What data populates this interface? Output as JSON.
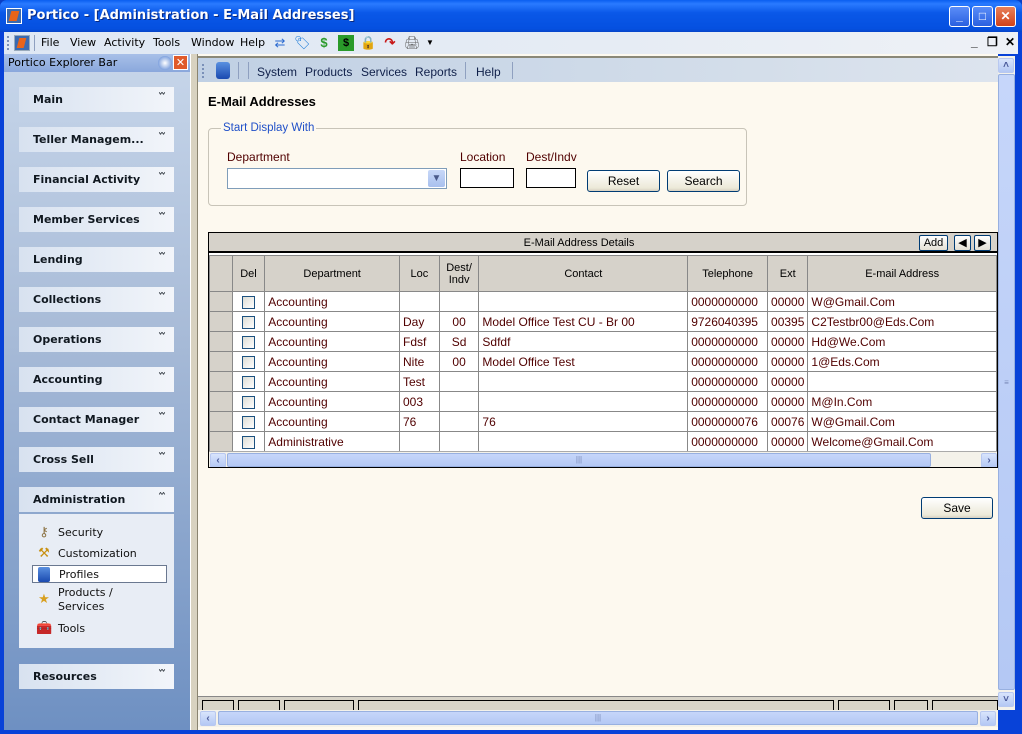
{
  "window": {
    "title": "Portico - [Administration - E-Mail Addresses]",
    "controls": {
      "minimize": "_",
      "maximize": "□",
      "close": "✕"
    }
  },
  "menubar": {
    "items": [
      "File",
      "View",
      "Activity",
      "Tools",
      "Window",
      "Help"
    ],
    "toolbar_icons": [
      "transfer-icon",
      "tag-icon",
      "dollar-icon",
      "cash-drawer-icon",
      "lock-icon",
      "redo-arrow-icon",
      "printer-icon"
    ],
    "mdi_controls": {
      "minimize": "_",
      "restore": "❐",
      "close": "✕"
    }
  },
  "explorer": {
    "title": "Portico Explorer Bar",
    "groups": [
      {
        "label": "Main",
        "expanded": false
      },
      {
        "label": "Teller Managem...",
        "expanded": false
      },
      {
        "label": "Financial Activity",
        "expanded": false
      },
      {
        "label": "Member Services",
        "expanded": false
      },
      {
        "label": "Lending",
        "expanded": false
      },
      {
        "label": "Collections",
        "expanded": false
      },
      {
        "label": "Operations",
        "expanded": false
      },
      {
        "label": "Accounting",
        "expanded": false
      },
      {
        "label": "Contact Manager",
        "expanded": false
      },
      {
        "label": "Cross Sell",
        "expanded": false
      },
      {
        "label": "Administration",
        "expanded": true
      },
      {
        "label": "Resources",
        "expanded": false
      }
    ],
    "admin_items": [
      {
        "label": "Security",
        "icon": "keys-icon",
        "selected": false
      },
      {
        "label": "Customization",
        "icon": "hardhat-hammer-icon",
        "selected": false
      },
      {
        "label": "Profiles",
        "icon": "profile-cabinet-icon",
        "selected": true
      },
      {
        "label": "Products / Services",
        "icon": "star-hand-icon",
        "selected": false
      },
      {
        "label": "Tools",
        "icon": "toolbox-icon",
        "selected": false
      }
    ]
  },
  "inner_toolbar": {
    "items": [
      "System",
      "Products",
      "Services",
      "Reports",
      "Help"
    ]
  },
  "page": {
    "title": "E-Mail Addresses",
    "filter": {
      "legend": "Start Display With",
      "department_label": "Department",
      "department_value": "",
      "location_label": "Location",
      "location_value": "",
      "destindv_label": "Dest/Indv",
      "destindv_value": "",
      "reset_label": "Reset",
      "search_label": "Search"
    },
    "grid": {
      "caption": "E-Mail Address Details",
      "add_label": "Add",
      "columns": [
        "Del",
        "Department",
        "Loc",
        "Dest/ Indv",
        "Contact",
        "Telephone",
        "Ext",
        "E-mail Address"
      ],
      "rows": [
        {
          "del": false,
          "department": "Accounting",
          "loc": "",
          "dest": "",
          "contact": "",
          "telephone": "0000000000",
          "ext": "00000",
          "email": "W@Gmail.Com"
        },
        {
          "del": false,
          "department": "Accounting",
          "loc": "Day",
          "dest": "00",
          "contact": "Model Office Test CU - Br 00",
          "telephone": "9726040395",
          "ext": "00395",
          "email": "C2Testbr00@Eds.Com"
        },
        {
          "del": false,
          "department": "Accounting",
          "loc": "Fdsf",
          "dest": "Sd",
          "contact": "Sdfdf",
          "telephone": "0000000000",
          "ext": "00000",
          "email": "Hd@We.Com"
        },
        {
          "del": false,
          "department": "Accounting",
          "loc": "Nite",
          "dest": "00",
          "contact": "Model Office Test",
          "telephone": "0000000000",
          "ext": "00000",
          "email": "1@Eds.Com"
        },
        {
          "del": false,
          "department": "Accounting",
          "loc": "Test",
          "dest": "",
          "contact": "",
          "telephone": "0000000000",
          "ext": "00000",
          "email": ""
        },
        {
          "del": false,
          "department": "Accounting",
          "loc": "003",
          "dest": "",
          "contact": "",
          "telephone": "0000000000",
          "ext": "00000",
          "email": "M@In.Com"
        },
        {
          "del": false,
          "department": "Accounting",
          "loc": "76",
          "dest": "",
          "contact": "76",
          "telephone": "0000000076",
          "ext": "00076",
          "email": "W@Gmail.Com"
        },
        {
          "del": false,
          "department": "Administrative",
          "loc": "",
          "dest": "",
          "contact": "",
          "telephone": "0000000000",
          "ext": "00000",
          "email": "Welcome@Gmail.Com"
        }
      ]
    },
    "save_label": "Save"
  },
  "colors": {
    "titlebar": "#0a58e8",
    "content_bg": "#fdf9ef",
    "grid_text": "#500000",
    "legend_text": "#2050c8"
  }
}
